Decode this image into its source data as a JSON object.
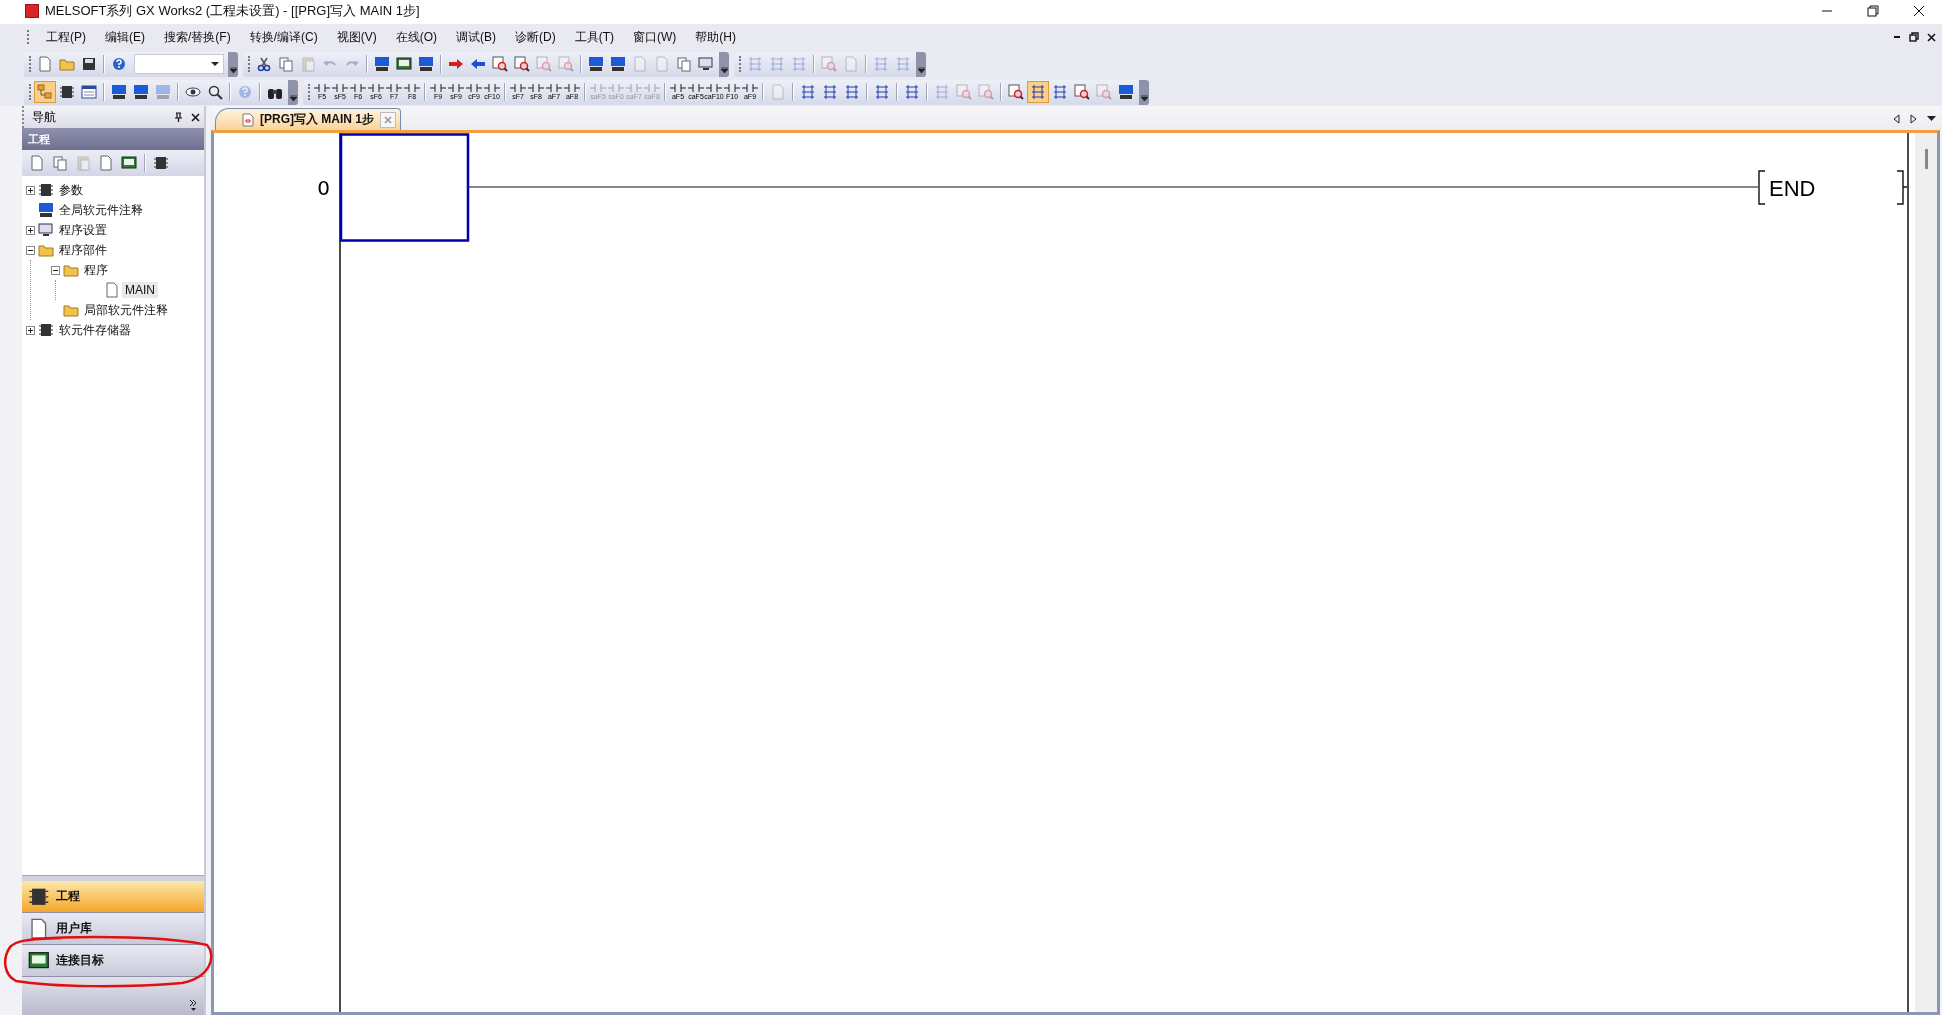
{
  "window": {
    "title": "MELSOFT系列 GX Works2 (工程未设置) - [[PRG]写入 MAIN 1步]"
  },
  "menu": [
    "工程(P)",
    "编辑(E)",
    "搜索/替换(F)",
    "转换/编译(C)",
    "视图(V)",
    "在线(O)",
    "调试(B)",
    "诊断(D)",
    "工具(T)",
    "窗口(W)",
    "帮助(H)"
  ],
  "toolbars": [
    [
      {
        "sections": [
          [
            {
              "kind": "icon",
              "disabled": false,
              "pressed": false
            },
            {
              "kind": "icon",
              "disabled": false,
              "pressed": false
            },
            {
              "kind": "icon",
              "disabled": false,
              "pressed": false
            }
          ],
          [
            {
              "kind": "icon",
              "disabled": false,
              "pressed": false
            },
            {
              "kind": "combo"
            }
          ]
        ]
      },
      {
        "sections": [
          [
            {
              "kind": "icon",
              "disabled": false,
              "pressed": false
            },
            {
              "kind": "icon",
              "disabled": false,
              "pressed": false
            },
            {
              "kind": "icon",
              "disabled": true,
              "pressed": false
            },
            {
              "kind": "icon",
              "disabled": true,
              "pressed": false
            },
            {
              "kind": "icon",
              "disabled": true,
              "pressed": false
            }
          ],
          [
            {
              "kind": "icon",
              "disabled": false,
              "pressed": false
            },
            {
              "kind": "icon",
              "disabled": false,
              "pressed": false
            },
            {
              "kind": "icon",
              "disabled": false,
              "pressed": false
            }
          ],
          [
            {
              "kind": "icon",
              "disabled": false,
              "pressed": false
            },
            {
              "kind": "icon",
              "disabled": false,
              "pressed": false
            },
            {
              "kind": "icon",
              "disabled": false,
              "pressed": false
            },
            {
              "kind": "icon",
              "disabled": false,
              "pressed": false
            },
            {
              "kind": "icon",
              "disabled": true,
              "pressed": false
            },
            {
              "kind": "icon",
              "disabled": true,
              "pressed": false
            }
          ],
          [
            {
              "kind": "icon",
              "disabled": false,
              "pressed": false
            },
            {
              "kind": "icon",
              "disabled": false,
              "pressed": false
            },
            {
              "kind": "icon",
              "disabled": true,
              "pressed": false
            },
            {
              "kind": "icon",
              "disabled": true,
              "pressed": false
            },
            {
              "kind": "icon",
              "disabled": false,
              "pressed": false
            },
            {
              "kind": "icon",
              "disabled": false,
              "pressed": false
            }
          ]
        ]
      },
      {
        "sections": [
          [
            {
              "kind": "icon",
              "disabled": true,
              "pressed": false
            },
            {
              "kind": "icon",
              "disabled": true,
              "pressed": false
            },
            {
              "kind": "icon",
              "disabled": true,
              "pressed": false
            }
          ],
          [
            {
              "kind": "icon",
              "disabled": true,
              "pressed": false
            },
            {
              "kind": "icon",
              "disabled": true,
              "pressed": false
            }
          ],
          [
            {
              "kind": "icon",
              "disabled": true,
              "pressed": false
            },
            {
              "kind": "icon",
              "disabled": true,
              "pressed": false
            }
          ]
        ]
      }
    ],
    [
      {
        "sections": [
          [
            {
              "kind": "icon",
              "disabled": false,
              "pressed": true
            },
            {
              "kind": "icon",
              "disabled": false,
              "pressed": false
            },
            {
              "kind": "icon",
              "disabled": false,
              "pressed": false
            }
          ],
          [
            {
              "kind": "icon",
              "disabled": false,
              "pressed": false
            },
            {
              "kind": "icon",
              "disabled": false,
              "pressed": false
            },
            {
              "kind": "icon",
              "disabled": true,
              "pressed": false
            }
          ],
          [
            {
              "kind": "icon",
              "disabled": false,
              "pressed": false
            },
            {
              "kind": "icon",
              "disabled": false,
              "pressed": false
            }
          ],
          [
            {
              "kind": "icon",
              "disabled": true,
              "pressed": false
            }
          ],
          [
            {
              "kind": "icon",
              "disabled": false,
              "pressed": false
            }
          ]
        ]
      },
      {
        "sections": [
          [
            {
              "kind": "ladder",
              "label": "F5",
              "disabled": false,
              "pressed": false
            },
            {
              "kind": "ladder",
              "label": "sF5",
              "disabled": false,
              "pressed": false
            },
            {
              "kind": "ladder",
              "label": "F6",
              "disabled": false,
              "pressed": false
            },
            {
              "kind": "ladder",
              "label": "sF6",
              "disabled": false,
              "pressed": false
            },
            {
              "kind": "ladder",
              "label": "F7",
              "disabled": false,
              "pressed": false
            },
            {
              "kind": "ladder",
              "label": "F8",
              "disabled": false,
              "pressed": false
            }
          ],
          [
            {
              "kind": "ladder",
              "label": "F9",
              "disabled": false,
              "pressed": false
            },
            {
              "kind": "ladder",
              "label": "sF9",
              "disabled": false,
              "pressed": false
            },
            {
              "kind": "ladder",
              "label": "cF9",
              "disabled": false,
              "pressed": false
            },
            {
              "kind": "ladder",
              "label": "cF10",
              "disabled": false,
              "pressed": false
            }
          ],
          [
            {
              "kind": "ladder",
              "label": "sF7",
              "disabled": false,
              "pressed": false
            },
            {
              "kind": "ladder",
              "label": "sF8",
              "disabled": false,
              "pressed": false
            },
            {
              "kind": "ladder",
              "label": "aF7",
              "disabled": false,
              "pressed": false
            },
            {
              "kind": "ladder",
              "label": "aF8",
              "disabled": false,
              "pressed": false
            }
          ],
          [
            {
              "kind": "ladder",
              "label": "saF5",
              "disabled": true,
              "pressed": false
            },
            {
              "kind": "ladder",
              "label": "saF6",
              "disabled": true,
              "pressed": false
            },
            {
              "kind": "ladder",
              "label": "saF7",
              "disabled": true,
              "pressed": false
            },
            {
              "kind": "ladder",
              "label": "saF8",
              "disabled": true,
              "pressed": false
            }
          ],
          [
            {
              "kind": "ladder",
              "label": "aF5",
              "disabled": false,
              "pressed": false
            },
            {
              "kind": "ladder",
              "label": "caF5",
              "disabled": false,
              "pressed": false
            },
            {
              "kind": "ladder",
              "label": "caF10",
              "disabled": false,
              "pressed": false
            },
            {
              "kind": "ladder",
              "label": "F10",
              "disabled": false,
              "pressed": false
            },
            {
              "kind": "ladder",
              "label": "aF9",
              "disabled": false,
              "pressed": false
            }
          ],
          [
            {
              "kind": "icon",
              "disabled": true,
              "pressed": false
            }
          ],
          [
            {
              "kind": "icon",
              "disabled": false,
              "pressed": false
            },
            {
              "kind": "icon",
              "disabled": false,
              "pressed": false
            },
            {
              "kind": "icon",
              "disabled": false,
              "pressed": false
            }
          ],
          [
            {
              "kind": "icon",
              "disabled": false,
              "pressed": false
            }
          ],
          [
            {
              "kind": "icon",
              "disabled": false,
              "pressed": false
            }
          ],
          [
            {
              "kind": "icon",
              "disabled": true,
              "pressed": false
            },
            {
              "kind": "icon",
              "disabled": true,
              "pressed": false
            },
            {
              "kind": "icon",
              "disabled": true,
              "pressed": false
            }
          ],
          [
            {
              "kind": "icon",
              "disabled": false,
              "pressed": false
            },
            {
              "kind": "icon",
              "disabled": false,
              "pressed": true
            },
            {
              "kind": "icon",
              "disabled": false,
              "pressed": false
            },
            {
              "kind": "icon",
              "disabled": false,
              "pressed": false
            },
            {
              "kind": "icon",
              "disabled": true,
              "pressed": false
            },
            {
              "kind": "icon",
              "disabled": false,
              "pressed": false
            }
          ]
        ]
      }
    ]
  ],
  "navigation": {
    "title": "导航",
    "section": "工程",
    "tree": [
      {
        "label": "参数",
        "expanded": false,
        "selected": false
      },
      {
        "label": "全局软元件注释",
        "selected": false
      },
      {
        "label": "程序设置",
        "expanded": false,
        "selected": false
      },
      {
        "label": "程序部件",
        "expanded": true,
        "selected": false,
        "children": [
          {
            "label": "程序",
            "expanded": true,
            "selected": false,
            "children": [
              {
                "label": "MAIN",
                "selected": true
              }
            ]
          },
          {
            "label": "局部软元件注释",
            "selected": false
          }
        ]
      },
      {
        "label": "软元件存储器",
        "expanded": false,
        "selected": false
      }
    ],
    "views": [
      {
        "label": "工程",
        "selected": true,
        "circled": false
      },
      {
        "label": "用户库",
        "selected": false,
        "circled": false
      },
      {
        "label": "连接目标",
        "selected": false,
        "circled": true
      }
    ]
  },
  "editor": {
    "tabs": [
      {
        "label": "[PRG]写入 MAIN 1步",
        "selected": true
      }
    ],
    "ladder": {
      "step": "0",
      "instruction": "END"
    }
  }
}
